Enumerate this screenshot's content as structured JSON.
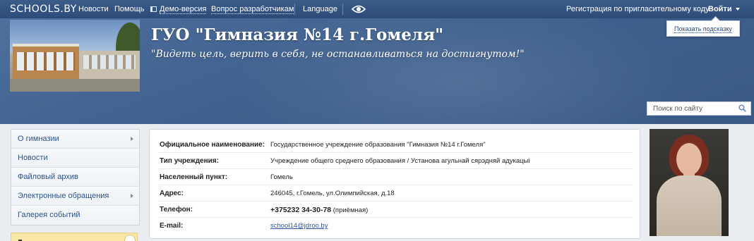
{
  "topbar": {
    "logo": "SCHOOLS.BY",
    "news": "Новости",
    "help": "Помощь",
    "demo": "Демо-версия",
    "dev_question": "Вопрос разработчикам",
    "language": "Language",
    "invite_registration": "Регистрация по пригласительному коду",
    "login": "Войти"
  },
  "hint": {
    "label": "Показать подсказку"
  },
  "header": {
    "title": "ГУО \"Гимназия №14 г.Гомеля\"",
    "motto": "\"Видеть цель, верить в себя, не останавливаться на достигнутом!\""
  },
  "search": {
    "placeholder": "Поиск по сайту"
  },
  "sidebar": {
    "items": [
      {
        "label": "О гимназии",
        "has_submenu": true
      },
      {
        "label": "Новости",
        "has_submenu": false
      },
      {
        "label": "Файловый архив",
        "has_submenu": false
      },
      {
        "label": "Электронные обращения",
        "has_submenu": true
      },
      {
        "label": "Галерея событий",
        "has_submenu": false
      }
    ]
  },
  "info": {
    "official_name": {
      "label": "Официальное наименование:",
      "value": "Государственное учреждение образования \"Гимназия №14 г.Гомеля\""
    },
    "type": {
      "label": "Тип учреждения:",
      "value": "Учреждение общего среднего образования / Установа агульнай сярэдняй адукацыі"
    },
    "locality": {
      "label": "Населенный пункт:",
      "value": "Гомель"
    },
    "address": {
      "label": "Адрес:",
      "value": "246045, г.Гомель, ул.Олимпийская, д.18"
    },
    "phone": {
      "label": "Телефон:",
      "value": "+375232 34-30-78",
      "note": "(приёмная)"
    },
    "email": {
      "label": "E-mail:",
      "value": "school14@jdroo.by"
    }
  },
  "colors": {
    "topbar": "#2d4b78",
    "banner": "#40618f",
    "link": "#2d5288",
    "notice": "#fbe7a6"
  },
  "icons": [
    "monitor-icon",
    "eye-icon",
    "search-icon",
    "chevron-right-icon"
  ]
}
